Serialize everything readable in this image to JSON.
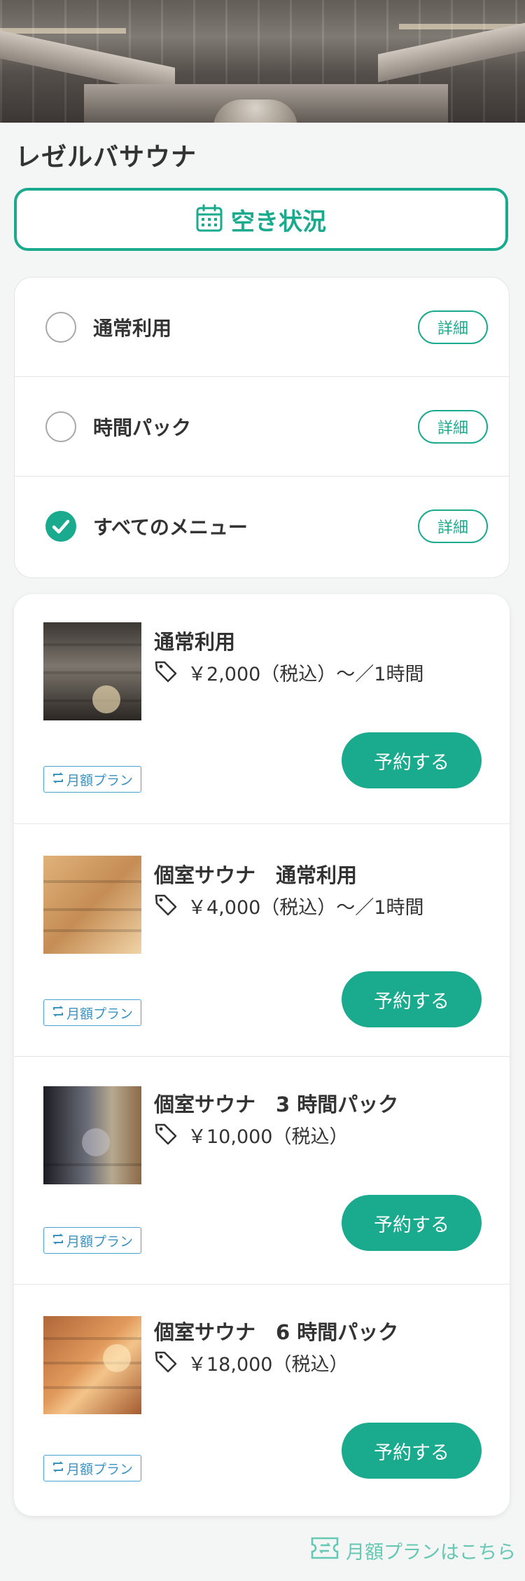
{
  "facility": {
    "name": "レゼルバサウナ"
  },
  "availability": {
    "label": "空き状況",
    "icon": "calendar-icon"
  },
  "filters": [
    {
      "label": "通常利用",
      "checked": false,
      "detail_label": "詳細"
    },
    {
      "label": "時間パック",
      "checked": false,
      "detail_label": "詳細"
    },
    {
      "label": "すべてのメニュー",
      "checked": true,
      "detail_label": "詳細"
    }
  ],
  "menus": [
    {
      "name": "通常利用",
      "price": "￥2,000（税込）〜／1時間",
      "badge": "月額プラン",
      "button": "予約する"
    },
    {
      "name": "個室サウナ　通常利用",
      "price": "￥4,000（税込）〜／1時間",
      "badge": "月額プラン",
      "button": "予約する"
    },
    {
      "name": "個室サウナ　3 時間パック",
      "price": "￥10,000（税込）",
      "badge": "月額プラン",
      "button": "予約する"
    },
    {
      "name": "個室サウナ　6 時間パック",
      "price": "￥18,000（税込）",
      "badge": "月額プラン",
      "button": "予約する"
    }
  ],
  "footer": {
    "monthly_link": "月額プランはこちら",
    "icon": "ticket-icon"
  },
  "colors": {
    "accent": "#1aaa8e",
    "badge": "#3b93c2",
    "link": "#65c8b4"
  }
}
